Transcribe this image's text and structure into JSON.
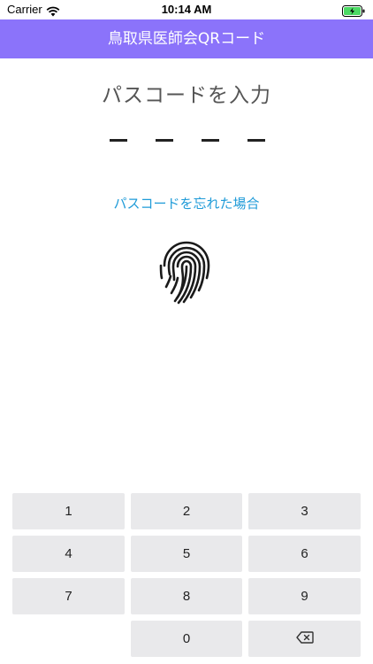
{
  "status_bar": {
    "carrier": "Carrier",
    "time": "10:14 AM",
    "wifi_icon": "wifi-icon",
    "battery_icon": "battery-charging-icon"
  },
  "nav": {
    "title": "鳥取県医師会QRコード",
    "background": "#8b73fa"
  },
  "passcode": {
    "prompt": "パスコードを入力",
    "digits_total": 4,
    "digits_entered": 0
  },
  "forgot_link": "パスコードを忘れた場合",
  "fingerprint_icon": "fingerprint-icon",
  "keypad": {
    "keys": [
      "1",
      "2",
      "3",
      "4",
      "5",
      "6",
      "7",
      "8",
      "9",
      "0"
    ],
    "delete_icon": "backspace-icon"
  },
  "colors": {
    "accent": "#8b73fa",
    "link": "#1f9bd8",
    "key_background": "#e9e9eb"
  }
}
